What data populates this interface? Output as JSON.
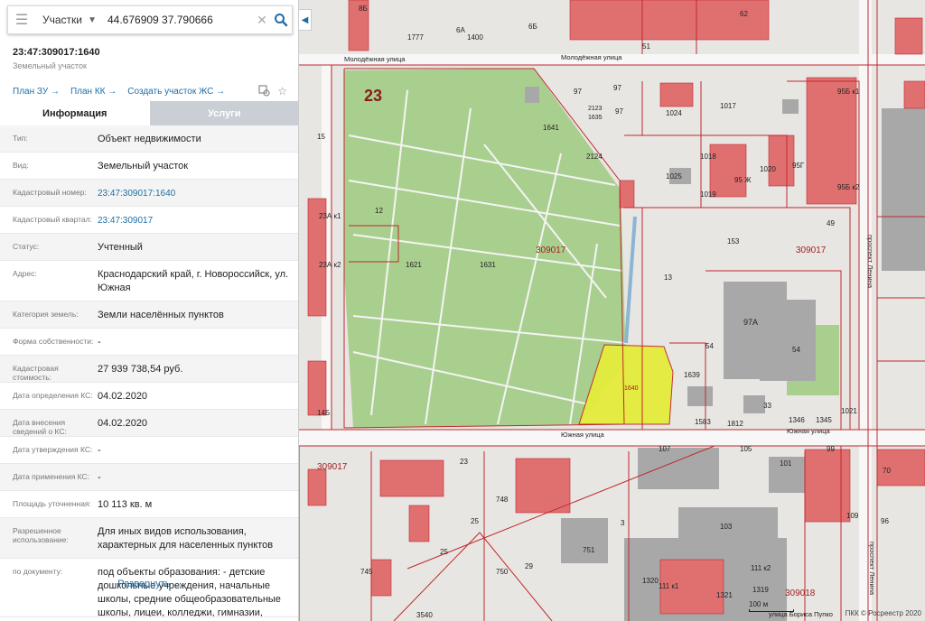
{
  "search": {
    "type_label": "Участки",
    "value": "44.676909 37.790666"
  },
  "object": {
    "number": "23:47:309017:1640",
    "subtitle": "Земельный участок"
  },
  "links": {
    "plan_zu": "План ЗУ →",
    "plan_kk": "План КК →",
    "create_zs": "Создать участок ЖС →"
  },
  "tabs": {
    "info": "Информация",
    "services": "Услуги"
  },
  "rows": [
    {
      "key": "Тип:",
      "value": "Объект недвижимости"
    },
    {
      "key": "Вид:",
      "value": "Земельный участок"
    },
    {
      "key": "Кадастровый номер:",
      "value": "23:47:309017:1640"
    },
    {
      "key": "Кадастровый квартал:",
      "value": "23:47:309017"
    },
    {
      "key": "Статус:",
      "value": "Учтенный"
    },
    {
      "key": "Адрес:",
      "value": "Краснодарский край, г. Новороссийск, ул. Южная"
    },
    {
      "key": "Категория земель:",
      "value": "Земли населённых пунктов"
    },
    {
      "key": "Форма собственности:",
      "value": "-"
    },
    {
      "key": "Кадастровая стоимость:",
      "value": "27 939 738,54 руб."
    },
    {
      "key": "Дата определения КС:",
      "value": "04.02.2020"
    },
    {
      "key": "Дата внесения сведений о КС:",
      "value": "04.02.2020"
    },
    {
      "key": "Дата утверждения КС:",
      "value": "-"
    },
    {
      "key": "Дата применения КС:",
      "value": "-"
    },
    {
      "key": "Площадь уточненная:",
      "value": "10 113 кв. м"
    },
    {
      "key": "Разрешенное использование:",
      "value": "Для иных видов использования, характерных для населенных пунктов"
    },
    {
      "key": "по документу:",
      "value": "под объекты образования: - детские дошкольные учреждения, начальные школы, средние общеобразовательные школы, лицеи, колледжи, гимназии, художественные"
    }
  ],
  "more_label": "Развернуть",
  "map": {
    "labels": {
      "street_molodezhnaya_1": "Молодёжная улица",
      "street_molodezhnaya_2": "Молодёжная улица",
      "street_yuzhnaya_1": "Южная улица",
      "street_yuzhnaya_2": "Южная улица",
      "prospekt_lenina_1": "проспект Ленина",
      "prospekt_lenina_2": "проспект Ленина",
      "street_pupko": "улица Бориса Пупко",
      "big_23": "23",
      "quarter_1": "309017",
      "quarter_2": "309017",
      "quarter_3": "309017",
      "quarter_4": "309018",
      "plot_1640": "1640",
      "plot_1631": "1631",
      "plot_1621": "1621",
      "plot_1641": "1641",
      "plot_1639": "1639",
      "plot_13": "13",
      "plot_153": "153",
      "plot_97A": "97А",
      "plot_54a": "54",
      "plot_54b": "54",
      "plot_49": "49",
      "plot_1583": "1583",
      "plot_1812": "1812",
      "plot_33": "33",
      "plot_1346": "1346",
      "plot_1345": "1345",
      "plot_1021": "1021",
      "plot_107": "107",
      "plot_105": "105",
      "plot_103": "103",
      "plot_101": "101",
      "plot_99": "99",
      "plot_109": "109",
      "plot_751": "751",
      "plot_750": "750",
      "plot_748": "748",
      "plot_25a": "25",
      "plot_25b": "25",
      "plot_29": "29",
      "plot_23": "23",
      "plot_3": "3",
      "plot_745": "745",
      "plot_1017": "1017",
      "plot_1024": "1024",
      "plot_1025": "1025",
      "plot_1018": "1018",
      "plot_1019": "1019",
      "plot_1020": "1020",
      "plot_95Zh": "95 Ж",
      "plot_95G": "95Г",
      "plot_95Bk1": "95Б к1",
      "plot_95Bk2": "95Б к2",
      "plot_97a": "97",
      "plot_97b": "97",
      "plot_97c": "97",
      "plot_2123": "2123",
      "plot_1635": "1635",
      "plot_2124": "2124",
      "plot_12": "12",
      "plot_23Ak1": "23А к1",
      "plot_23Ak2": "23А к2",
      "plot_15": "15",
      "plot_14B": "14Б",
      "plot_62": "62",
      "plot_51": "51",
      "plot_1777": "1777",
      "plot_1400": "1400",
      "plot_6A": "6А",
      "plot_6B": "6Б",
      "plot_8B": "8Б",
      "plot_1320": "1320",
      "plot_1321": "1321",
      "plot_1319": "1319",
      "plot_111k1": "111 к1",
      "plot_111k2": "111 к2",
      "plot_70": "70",
      "plot_96": "96",
      "plot_3540": "3540"
    },
    "scale_label": "100 м",
    "copyright": "ПКК © Росреестр 2020",
    "highlight_color": "#e4ec3a",
    "boundary_color": "#c0282d"
  }
}
